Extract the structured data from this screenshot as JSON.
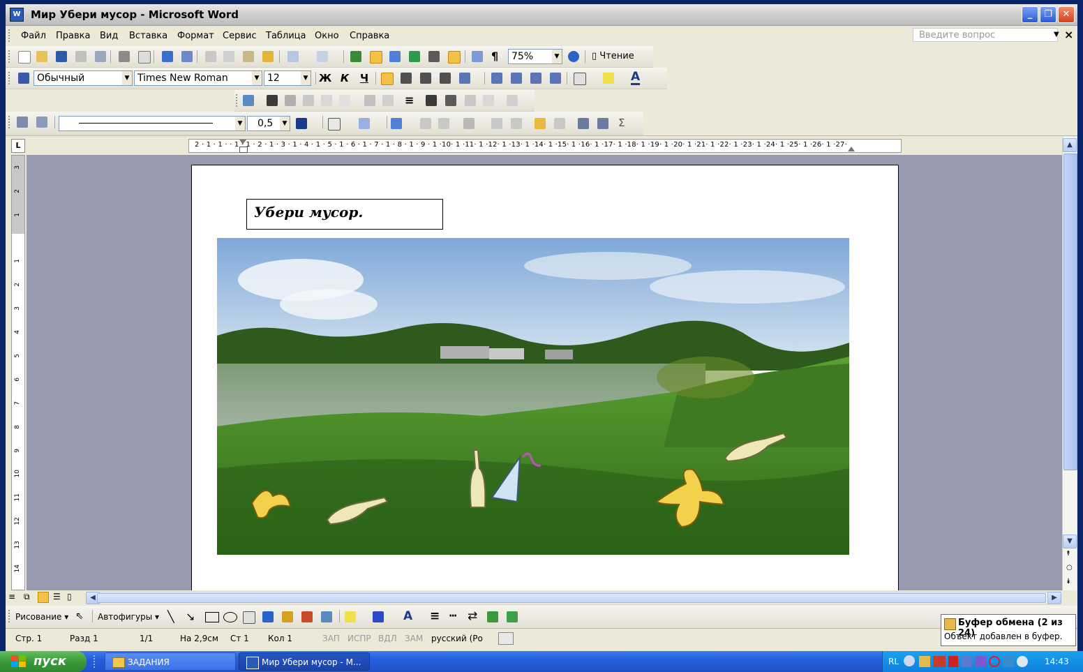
{
  "window": {
    "title": "Мир Убери мусор - Microsoft Word",
    "icon_label": "W"
  },
  "menu": {
    "items": [
      "Файл",
      "Правка",
      "Вид",
      "Вставка",
      "Формат",
      "Сервис",
      "Таблица",
      "Окно",
      "Справка"
    ],
    "ask_placeholder": "Введите вопрос",
    "close_glyph": "×"
  },
  "standard_toolbar": {
    "zoom": "75%",
    "reading_label": "Чтение",
    "pilcrow": "¶"
  },
  "format_toolbar": {
    "style": "Обычный",
    "font": "Times New Roman",
    "size": "12",
    "bold": "Ж",
    "italic": "К",
    "underline": "Ч"
  },
  "draw_props_toolbar": {
    "line_weight": "0,5",
    "sigma": "Σ"
  },
  "ruler": {
    "tab_selector": "L",
    "horizontal_numbers": "2 · 1 · 1 ·   · 1 · 1 · 2 · 1 · 3 · 1 · 4 · 1 · 5 · 1 · 6 · 1 · 7 · 1 · 8 · 1 · 9 · 1 ·10· 1 ·11· 1 ·12· 1 ·13· 1 ·14· 1 ·15· 1 ·16· 1 ·17· 1 ·18· 1 ·19· 1 ·20· 1 ·21· 1 ·22· 1 ·23· 1 ·24· 1 ·25· 1 ·26· 1 ·27·",
    "vertical_numbers": [
      "3",
      "2",
      "1",
      "1",
      "2",
      "3",
      "4",
      "5",
      "6",
      "7",
      "8",
      "9",
      "10",
      "11",
      "12",
      "13",
      "14"
    ]
  },
  "document": {
    "textbox_text": "Убери мусор."
  },
  "drawing_toolbar": {
    "draw_label": "Рисование",
    "autoshapes_label": "Автофигуры"
  },
  "status": {
    "page": "Стр. 1",
    "section": "Разд 1",
    "pages": "1/1",
    "at": "На 2,9см",
    "line": "Ст 1",
    "col": "Кол 1",
    "rec": "ЗАП",
    "trk": "ИСПР",
    "ext": "ВДЛ",
    "ovr": "ЗАМ",
    "language": "русский (Ро"
  },
  "clipboard_notice": {
    "title": "Буфер обмена (2 из 24)",
    "message": "Объект добавлен в буфер."
  },
  "taskbar": {
    "start_label": "пуск",
    "buttons": [
      "ЗАДАНИЯ",
      "Мир Убери мусор - M..."
    ],
    "language": "RL",
    "clock": "14:43"
  }
}
